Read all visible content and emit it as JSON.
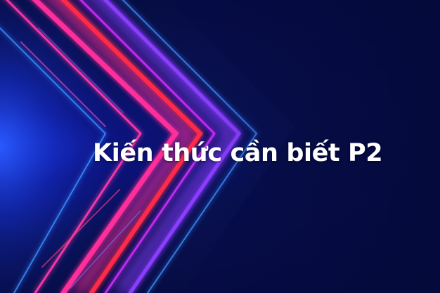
{
  "banner": {
    "headline": "Kiến thức cần biết P2",
    "theme_colors": {
      "background": "#070a44",
      "neon_pink": "#ff2e9a",
      "neon_red": "#ff2a4a",
      "neon_violet": "#8a3cff",
      "neon_blue": "#3a8dff",
      "text": "#ffffff"
    }
  }
}
